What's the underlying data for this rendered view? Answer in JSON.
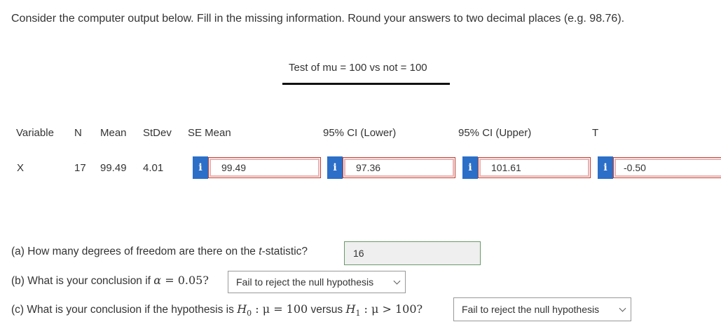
{
  "instructions": "Consider the computer output below. Fill in the missing information. Round your answers to two decimal places (e.g. 98.76).",
  "test_title": "Test of mu = 100 vs not = 100",
  "headers": {
    "variable": "Variable",
    "n": "N",
    "mean": "Mean",
    "stdev": "StDev",
    "se_mean": "SE Mean",
    "ci_lower": "95% CI (Lower)",
    "ci_upper": "95% CI (Upper)",
    "t": "T"
  },
  "row": {
    "variable": "X",
    "n": "17",
    "mean": "99.49",
    "stdev": "4.01"
  },
  "answers": {
    "info_glyph": "i",
    "se_mean": "99.49",
    "ci_lower": "97.36",
    "ci_upper": "101.61",
    "t": "-0.50"
  },
  "questions": {
    "a_prefix": "(a) How many degrees of freedom are there on the ",
    "a_italic": "t",
    "a_suffix": "-statistic?",
    "a_value": "16",
    "b_prefix": "(b) What is your conclusion if ",
    "b_math_alpha": "α",
    "b_math_rest": " = 0.05?",
    "b_selected": "Fail to reject the null hypothesis",
    "c_prefix": "(c) What is your conclusion if the hypothesis is ",
    "c_h0": "H",
    "c_h0_sub": "0",
    "c_h0_rest": " : μ = 100",
    "c_versus": " versus ",
    "c_h1": "H",
    "c_h1_sub": "1",
    "c_h1_rest": " : μ > 100?",
    "c_selected": "Fail to reject the null hypothesis"
  },
  "colors": {
    "info_badge": "#2c6fc8",
    "incorrect_border": "#c0392b",
    "correct_border": "#6a9a6a"
  }
}
